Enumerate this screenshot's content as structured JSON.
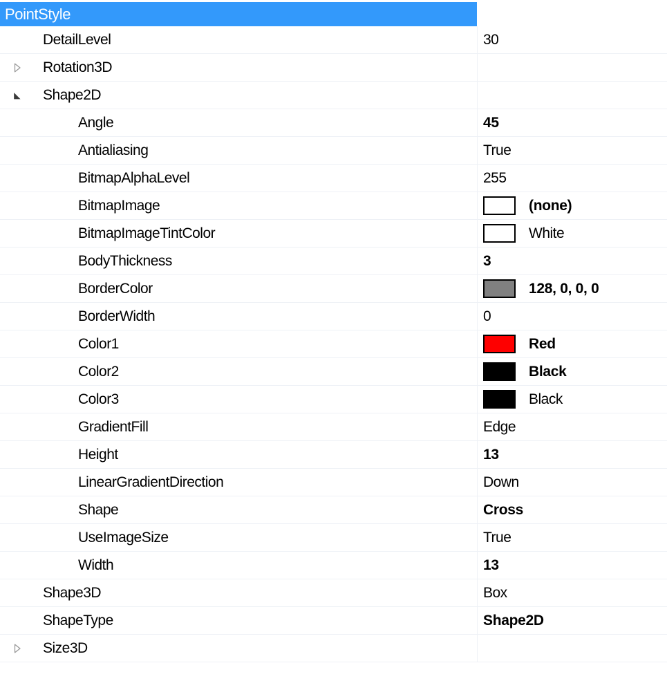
{
  "grid": {
    "category_header": "PointStyle",
    "header_color": "#3399fb",
    "header_text_color": "#ffffff",
    "row_separator_color": "#eef1f6"
  },
  "rows": [
    {
      "name": "DetailLevel",
      "level": 1,
      "expander": "none",
      "value": "30",
      "bold": false,
      "swatch": null
    },
    {
      "name": "Rotation3D",
      "level": 1,
      "expander": "collapsed",
      "value": "",
      "bold": false,
      "swatch": null
    },
    {
      "name": "Shape2D",
      "level": 1,
      "expander": "expanded",
      "value": "",
      "bold": false,
      "swatch": null
    },
    {
      "name": "Angle",
      "level": 2,
      "expander": "none",
      "value": "45",
      "bold": true,
      "swatch": null
    },
    {
      "name": "Antialiasing",
      "level": 2,
      "expander": "none",
      "value": "True",
      "bold": false,
      "swatch": null
    },
    {
      "name": "BitmapAlphaLevel",
      "level": 2,
      "expander": "none",
      "value": "255",
      "bold": false,
      "swatch": null
    },
    {
      "name": "BitmapImage",
      "level": 2,
      "expander": "none",
      "value": "(none)",
      "bold": true,
      "swatch": "#ffffff"
    },
    {
      "name": "BitmapImageTintColor",
      "level": 2,
      "expander": "none",
      "value": "White",
      "bold": false,
      "swatch": "#ffffff"
    },
    {
      "name": "BodyThickness",
      "level": 2,
      "expander": "none",
      "value": "3",
      "bold": true,
      "swatch": null
    },
    {
      "name": "BorderColor",
      "level": 2,
      "expander": "none",
      "value": "128, 0, 0, 0",
      "bold": true,
      "swatch": "#808080"
    },
    {
      "name": "BorderWidth",
      "level": 2,
      "expander": "none",
      "value": "0",
      "bold": false,
      "swatch": null
    },
    {
      "name": "Color1",
      "level": 2,
      "expander": "none",
      "value": "Red",
      "bold": true,
      "swatch": "#fe0000"
    },
    {
      "name": "Color2",
      "level": 2,
      "expander": "none",
      "value": "Black",
      "bold": true,
      "swatch": "#000000"
    },
    {
      "name": "Color3",
      "level": 2,
      "expander": "none",
      "value": "Black",
      "bold": false,
      "swatch": "#000000"
    },
    {
      "name": "GradientFill",
      "level": 2,
      "expander": "none",
      "value": "Edge",
      "bold": false,
      "swatch": null
    },
    {
      "name": "Height",
      "level": 2,
      "expander": "none",
      "value": "13",
      "bold": true,
      "swatch": null
    },
    {
      "name": "LinearGradientDirection",
      "level": 2,
      "expander": "none",
      "value": "Down",
      "bold": false,
      "swatch": null
    },
    {
      "name": "Shape",
      "level": 2,
      "expander": "none",
      "value": "Cross",
      "bold": true,
      "swatch": null
    },
    {
      "name": "UseImageSize",
      "level": 2,
      "expander": "none",
      "value": "True",
      "bold": false,
      "swatch": null
    },
    {
      "name": "Width",
      "level": 2,
      "expander": "none",
      "value": "13",
      "bold": true,
      "swatch": null
    },
    {
      "name": "Shape3D",
      "level": 1,
      "expander": "none",
      "value": "Box",
      "bold": false,
      "swatch": null
    },
    {
      "name": "ShapeType",
      "level": 1,
      "expander": "none",
      "value": "Shape2D",
      "bold": true,
      "swatch": null
    },
    {
      "name": "Size3D",
      "level": 1,
      "expander": "collapsed",
      "value": "",
      "bold": false,
      "swatch": null
    }
  ]
}
